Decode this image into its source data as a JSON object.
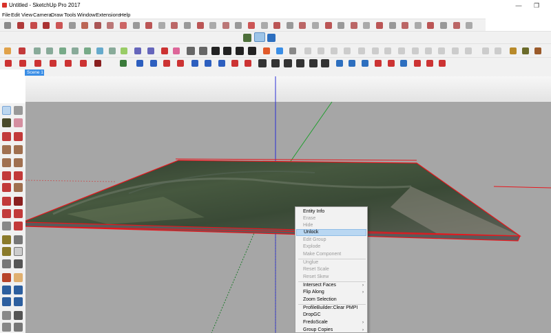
{
  "window": {
    "title": "Untitled - SketchUp Pro 2017",
    "minimize_glyph": "—",
    "maximize_glyph": "❐"
  },
  "menubar": [
    "File",
    "Edit",
    "View",
    "Camera",
    "Draw",
    "Tools",
    "Window",
    "Extensions",
    "Help"
  ],
  "scene_tab": "Scene 1",
  "context_menu": {
    "items": [
      {
        "label": "Entity Info",
        "enabled": true
      },
      {
        "label": "Erase",
        "enabled": false
      },
      {
        "label": "Hide",
        "enabled": false
      },
      {
        "label": "Unlock",
        "enabled": true,
        "highlighted": true
      },
      {
        "label": "Edit Group",
        "enabled": false
      },
      {
        "label": "Explode",
        "enabled": false
      },
      {
        "label": "Make Component",
        "enabled": false
      },
      {
        "label": "Unglue",
        "enabled": false
      },
      {
        "label": "Reset Scale",
        "enabled": false
      },
      {
        "label": "Reset Skew",
        "enabled": false
      },
      {
        "label": "Intersect Faces",
        "enabled": true,
        "submenu": true
      },
      {
        "label": "Flip Along",
        "enabled": true,
        "submenu": true
      },
      {
        "label": "Zoom Selection",
        "enabled": true
      },
      {
        "label": "ProfileBuilder:Clear PMPI",
        "enabled": true
      },
      {
        "label": "DropGC",
        "enabled": true
      },
      {
        "label": "FredoScale",
        "enabled": true,
        "submenu": true
      },
      {
        "label": "Group Copies",
        "enabled": true,
        "submenu": true
      }
    ],
    "submenu_glyph": "›"
  },
  "colors": {
    "selection": "#e8161c",
    "axis_red": "#e8161c",
    "axis_green": "#1f9e2d",
    "axis_blue": "#2b2fd6",
    "sky": "#ececec",
    "ground": "#a6a6a6",
    "menu_highlight": "#b9d7f2",
    "scene_tab": "#3a8ee6"
  },
  "viewport": {
    "model": "terrain-image-group",
    "selected": true
  }
}
